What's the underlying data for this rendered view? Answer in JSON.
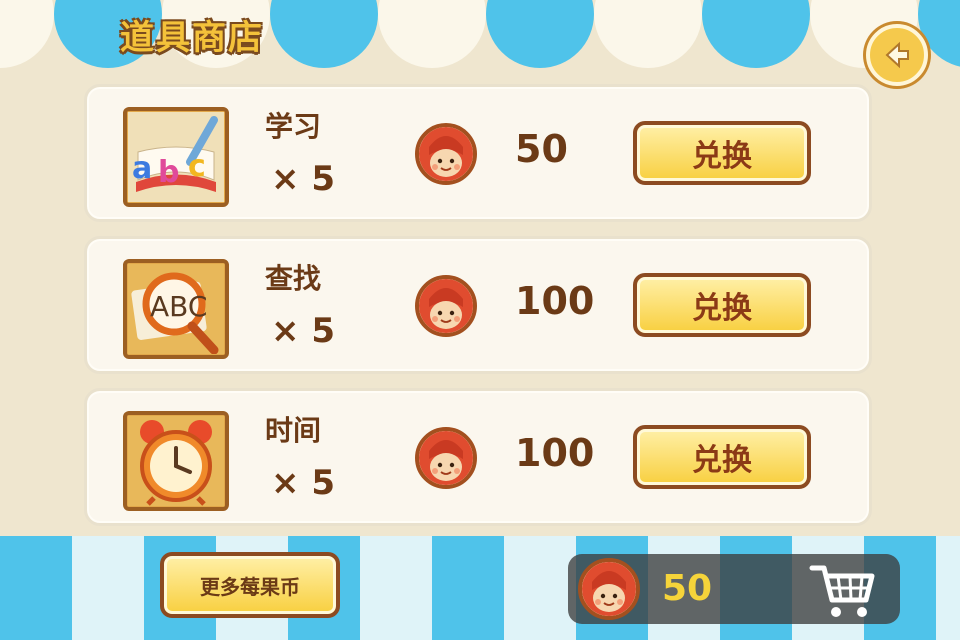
{
  "title": "道具商店",
  "items": [
    {
      "name": "学习",
      "qty": "× 5",
      "price": "50",
      "button": "兑换",
      "icon": "abc-book-pencil-icon"
    },
    {
      "name": "查找",
      "qty": "× 5",
      "price": "100",
      "button": "兑换",
      "icon": "magnifier-abc-icon"
    },
    {
      "name": "时间",
      "qty": "× 5",
      "price": "100",
      "button": "兑换",
      "icon": "alarm-clock-icon"
    }
  ],
  "more_coins_label": "更多莓果币",
  "balance": "50",
  "colors": {
    "awning_blue": "#4fc3ea",
    "button_yellow": "#f8cf3e",
    "text_brown": "#6b3a16"
  }
}
